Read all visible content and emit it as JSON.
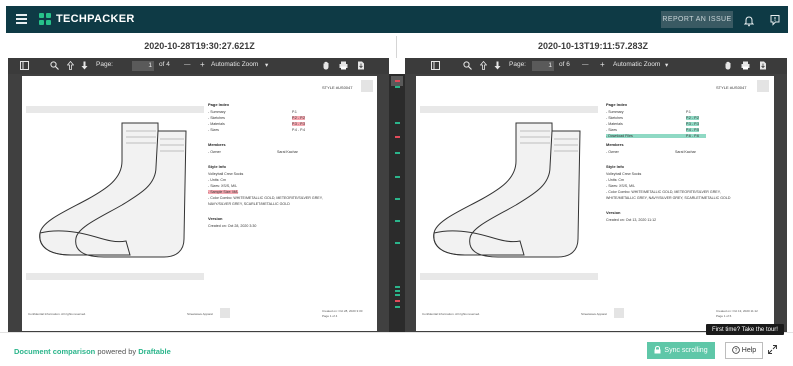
{
  "header": {
    "brand": "TECHPACKER",
    "report_label": "REPORT AN ISSUE",
    "icons": [
      "menu-icon",
      "bell-icon",
      "chat-icon"
    ]
  },
  "comparison": {
    "left_timestamp": "2020-10-28T19:30:27.621Z",
    "right_timestamp": "2020-10-13T19:11:57.283Z"
  },
  "left_toolbar": {
    "page_label": "Page:",
    "page_value": "1",
    "page_total": "of 4",
    "zoom_label": "Automatic Zoom",
    "minus": "—",
    "plus": "+"
  },
  "right_toolbar": {
    "page_label": "Page:",
    "page_value": "1",
    "page_total": "of 6",
    "zoom_label": "Automatic Zoom",
    "minus": "—",
    "plus": "+"
  },
  "left_doc": {
    "style_no": "STYLE #US0047",
    "page_index_title": "Page Index",
    "index": [
      {
        "label": "- Summary",
        "val": "P.1"
      },
      {
        "label": "- Sketches",
        "val": "P.2 - P.2"
      },
      {
        "label": "- Materials",
        "val": "P.3 - P.3"
      },
      {
        "label": "- Sizes",
        "val": "P.4 - P.4"
      }
    ],
    "members_title": "Members",
    "owner_label": "- Owner",
    "owner_name": "Sarai Kachar",
    "style_info_title": "Style Info",
    "style_name": "Volleyball Crew Socks",
    "units": "- Units: Cm",
    "sizes": "- Sizes: XS/S, M/L",
    "sample": "- Sample Size: M/L",
    "colors_1": "- Color Combo: WHITE/METALLIC GOLD, METEORITE/SILVER GREY,",
    "colors_2": "NAVY/SILVER GREY, SCARLET/METALLIC GOLD",
    "version_title": "Version",
    "created": "Created on: Oct 28, 2020 3:30",
    "footer_left": "Confidential Information. All rights reserved.",
    "footer_mid": "Streetwave Apparel",
    "footer_right_1": "Created on: Oct 28, 2020 3:30",
    "footer_right_2": "Page 1 of 4"
  },
  "right_doc": {
    "style_no": "STYLE #US0047",
    "page_index_title": "Page Index",
    "index": [
      {
        "label": "- Summary",
        "val": "P.1"
      },
      {
        "label": "- Sketches",
        "val": "P.2 - P.2"
      },
      {
        "label": "- Materials",
        "val": "P.3 - P.3"
      },
      {
        "label": "- Sizes",
        "val": "P.4 - P.5"
      },
      {
        "label": "- Download Files",
        "val": "P.6 - P.6"
      }
    ],
    "members_title": "Members",
    "owner_label": "- Owner",
    "owner_name": "Sarai Kachar",
    "style_info_title": "Style Info",
    "style_name": "Volleyball Crew Socks",
    "units": "- Units: Cm",
    "sizes": "- Sizes: XS/S, M/L",
    "colors_1": "- Color Combo: WHITE/METALLIC GOLD, METEORITE/SILVER GREY,",
    "colors_2": "WHITE/METALLIC GREY, NAVY/SILVER GREY, SCARLET/METALLIC GOLD",
    "version_title": "Version",
    "created": "Created on: Oct 13, 2020 11:12",
    "footer_left": "Confidential Information. All rights reserved.",
    "footer_mid": "Streetwave Apparel",
    "footer_right_1": "Created on: Oct 13, 2020 11:12",
    "footer_right_2": "Page 1 of 6"
  },
  "footer": {
    "powered_doc": "Document comparison",
    "powered_mid": "powered by",
    "powered_brand": "Draftable",
    "sync_label": "Sync scrolling",
    "help_label": "Help",
    "tour_tip": "First time? Take the tour!"
  },
  "colors": {
    "header_bg": "#0e3a45",
    "accent": "#2bb58b",
    "deletion": "#f4a7b0",
    "insertion": "#8fd9c4"
  }
}
